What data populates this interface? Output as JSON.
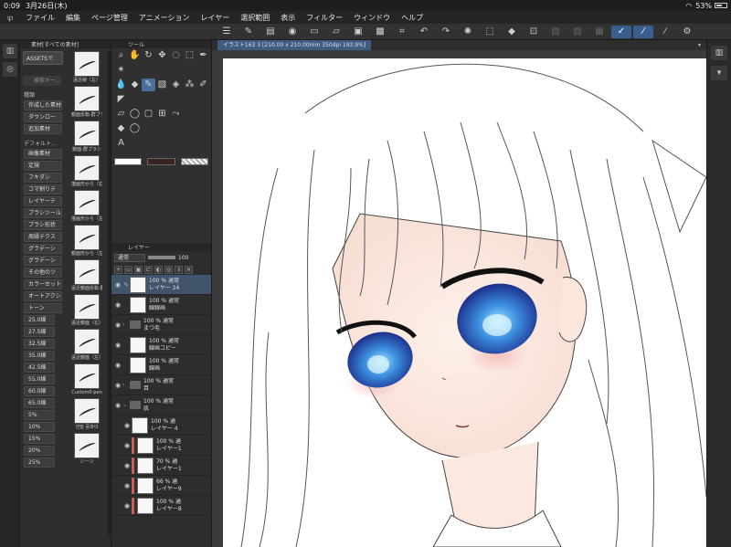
{
  "status": {
    "time": "0:09",
    "date": "3月26日(木)",
    "battery": "53%"
  },
  "menubar": [
    "ファイル",
    "編集",
    "ページ管理",
    "アニメーション",
    "レイヤー",
    "選択範囲",
    "表示",
    "フィルター",
    "ウィンドウ",
    "ヘルプ"
  ],
  "toolbar_icons": [
    "menu-icon",
    "edit-icon",
    "layer-icon",
    "view-icon",
    "folder-icon",
    "open-icon",
    "save-icon",
    "fill-icon",
    "crop-icon",
    "undo-icon",
    "redo-icon",
    "spinner-icon",
    "transform-icon",
    "fill-bucket-icon",
    "crop2-icon",
    "disabled-a-icon",
    "disabled-b-icon",
    "disabled-c-icon",
    "pen-active-icon",
    "brush-active-icon",
    "stroke-icon",
    "settings-icon"
  ],
  "material": {
    "title": "素材[すべての素材]",
    "assets_button": "ASSETSで",
    "search_placeholder": "検索キー...",
    "section_kind": "種類",
    "kind_items": [
      "作成した素材",
      "ダウンロー",
      "追加素材"
    ],
    "section_default": "デフォルト...",
    "default_items": [
      "画像素材",
      "定規",
      "フキダシ",
      "コマ割りテ",
      "レイヤーテ",
      "ブラシツール",
      "ブラシ形状",
      "周縁テクス",
      "グラデーシ",
      "グラデーシ",
      "その他のツ",
      "カラーセット",
      "オートアクシ",
      "トーン"
    ],
    "tone_items": [
      "25.0線",
      "27.5線",
      "32.5線",
      "35.0線",
      "42.5線",
      "55.0線",
      "60.0線",
      "65.0線",
      "5%",
      "10%",
      "15%",
      "20%",
      "25%"
    ],
    "thumbnails": [
      "遠近線（左）",
      "鏡面反転-群ブラシ",
      "鏡面-群ブラシ",
      "描画形から（右）",
      "描画形から（左）",
      "鏡面形から（左）",
      "遠近鏡面反転-群",
      "遠近鏡面（右）-群",
      "遠近鏡面（左）-群",
      "Custom0-pen",
      "민밀 뭉파이",
      "シーツ"
    ]
  },
  "tools": {
    "title": "ツール"
  },
  "layers": {
    "title": "レイヤー",
    "blend_mode": "通常",
    "opacity": "100",
    "rows": [
      {
        "pct": "100 % 通常",
        "name": "レイヤー 24",
        "kind": "layer",
        "active": true,
        "indent": false
      },
      {
        "pct": "100 % 通常",
        "name": "線線画",
        "kind": "layer",
        "active": false,
        "indent": false
      },
      {
        "pct": "100 % 通常",
        "name": "まつ毛",
        "kind": "folder",
        "active": false,
        "indent": false
      },
      {
        "pct": "100 % 通常",
        "name": "線画コピー",
        "kind": "layer",
        "active": false,
        "indent": false
      },
      {
        "pct": "100 % 通常",
        "name": "線画",
        "kind": "layer",
        "active": false,
        "indent": false
      },
      {
        "pct": "100 % 通常",
        "name": "目",
        "kind": "folder",
        "active": false,
        "indent": false
      },
      {
        "pct": "100 % 通常",
        "name": "肌",
        "kind": "folder-open",
        "active": false,
        "indent": false
      },
      {
        "pct": "100 % 通",
        "name": "レイヤー 4",
        "kind": "layer",
        "active": false,
        "indent": true
      },
      {
        "pct": "100 % 通",
        "name": "レイヤー1",
        "kind": "red",
        "active": false,
        "indent": true
      },
      {
        "pct": "70 % 通",
        "name": "レイヤー1",
        "kind": "red",
        "active": false,
        "indent": true
      },
      {
        "pct": "66 % 通",
        "name": "レイヤー9",
        "kind": "red",
        "active": false,
        "indent": true
      },
      {
        "pct": "100 % 通",
        "name": "レイヤー8",
        "kind": "red",
        "active": false,
        "indent": true
      }
    ]
  },
  "canvas": {
    "tab_title": "イラスト163 3 [210.00 x 210.00mm 350dpi 193.9%]"
  }
}
